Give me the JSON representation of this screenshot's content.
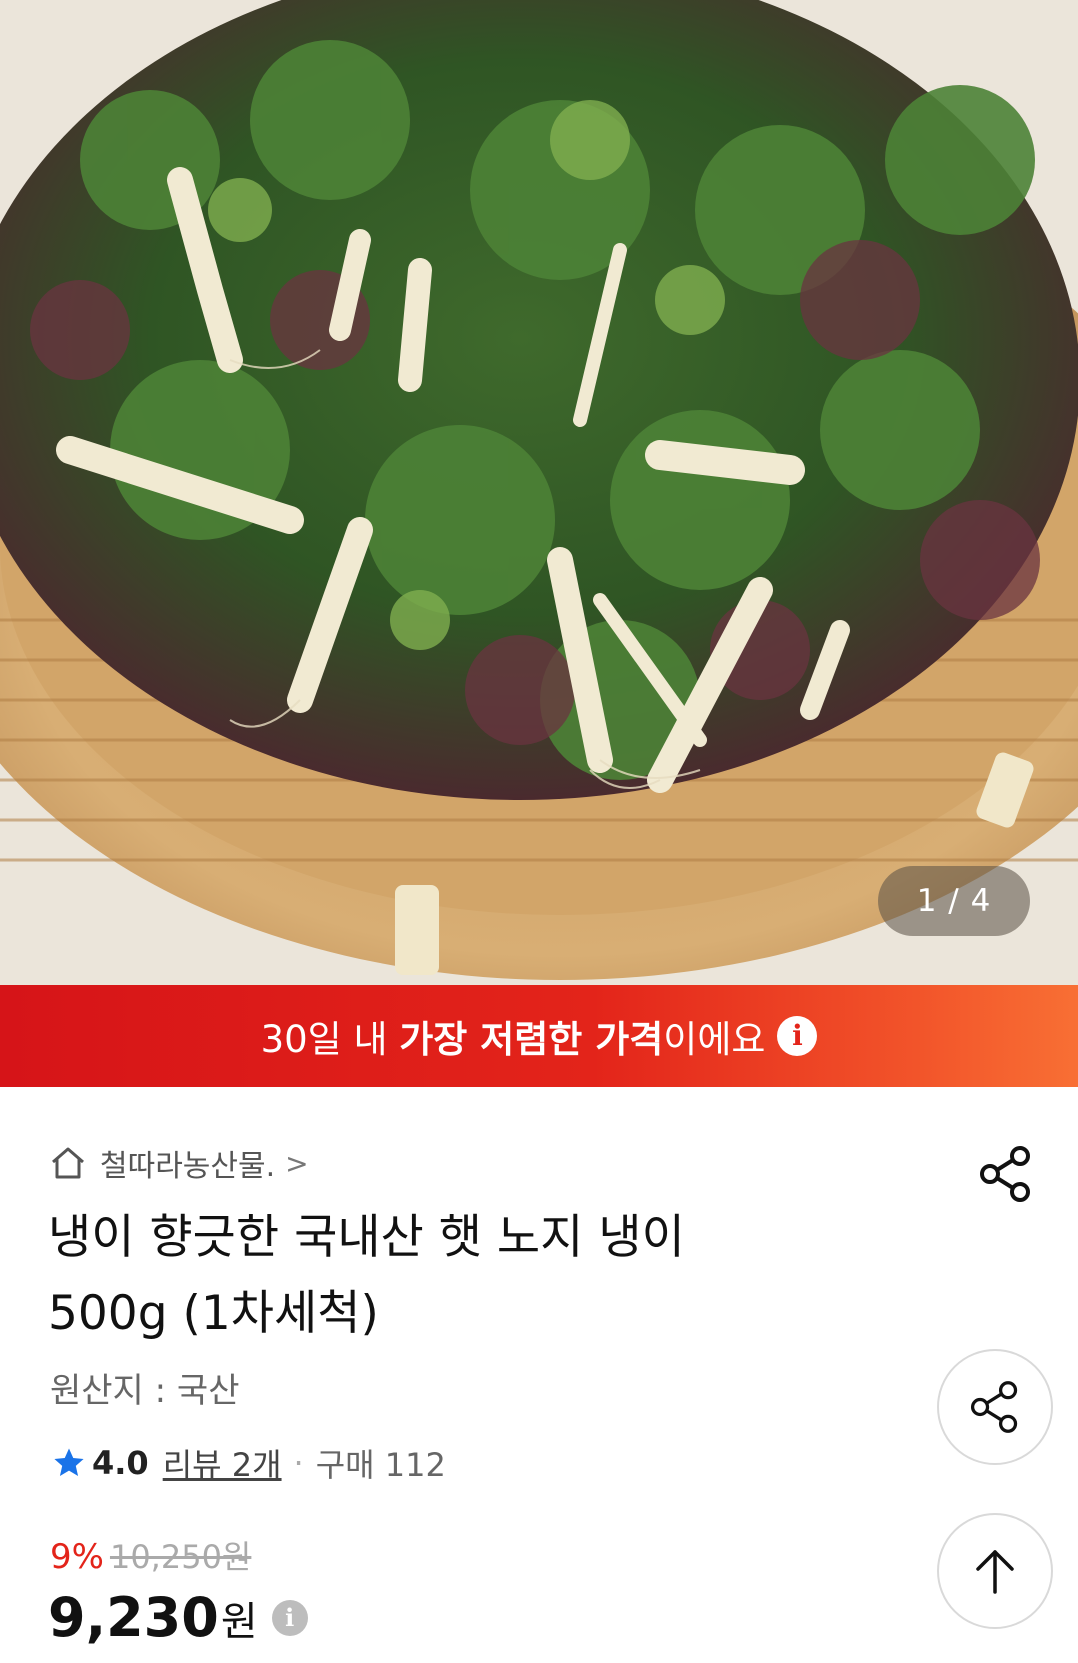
{
  "gallery": {
    "current": "1",
    "separator": " / ",
    "total": "4"
  },
  "banner": {
    "prefix": "30일 내 ",
    "highlight": "가장 저렴한 가격",
    "suffix": "이에요",
    "info_icon": "info-icon"
  },
  "seller": {
    "icon": "home-icon",
    "name": "철따라농산물.",
    "chevron": ">"
  },
  "product": {
    "title_line1": "냉이 향긋한 국내산 햇 노지 냉이",
    "title_line2": "500g (1차세척)",
    "origin": "원산지 : 국산"
  },
  "rating": {
    "icon": "star-icon",
    "score": "4.0",
    "review_label": "리뷰 2개",
    "separator": "·",
    "purchase_label": "구매 112"
  },
  "price": {
    "discount": "9%",
    "original": "10,250원",
    "current": "9,230",
    "unit": "원",
    "info_icon": "info-icon"
  },
  "actions": {
    "share_icon": "share-icon",
    "scroll_top_icon": "arrow-up-icon"
  },
  "colors": {
    "banner_start": "#d61418",
    "banner_end": "#f86f34",
    "discount_red": "#e3241a",
    "star_blue": "#1a73e8"
  }
}
